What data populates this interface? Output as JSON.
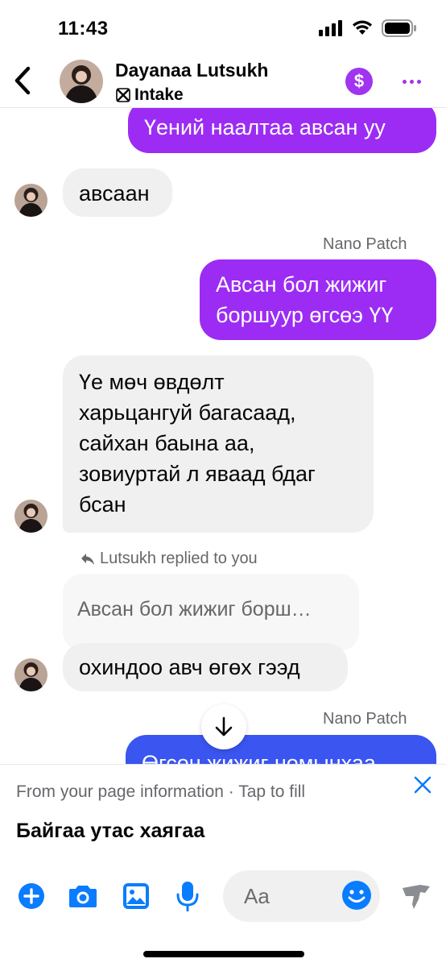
{
  "status_bar": {
    "time": "11:43"
  },
  "header": {
    "contact_name": "Dayanaa Lutsukh",
    "channel_label": "Intake"
  },
  "messages": [
    {
      "id": "m1",
      "direction": "outgoing",
      "text": "Үений наалтаа авсан уу"
    },
    {
      "id": "m2",
      "direction": "incoming",
      "text": "авсаан"
    },
    {
      "id": "m3",
      "direction": "outgoing",
      "sender": "Nano Patch",
      "lines": [
        "Авсан бол жижиг",
        "боршуур өгсөэ ҮҮ"
      ]
    },
    {
      "id": "m4",
      "direction": "incoming",
      "lines": [
        "Үе мөч өвдөлт",
        "харьцангуй багасаад,",
        "сайхан баына аа,",
        "зовиуртай л яваад бдаг",
        "бсан"
      ]
    },
    {
      "id": "m5",
      "direction": "incoming",
      "reply_label": "Lutsukh replied to you",
      "quoted": "Авсан бол жижиг борш…",
      "text": "охиндоо авч өгөх гээд"
    },
    {
      "id": "m6",
      "direction": "outgoing",
      "sender": "Nano Patch",
      "text": "Өгсөн жижиг номынхаа"
    }
  ],
  "suggestion": {
    "hint": "From your page information · Tap to fill",
    "text": "Байгаа утас хаягаа"
  },
  "composer": {
    "placeholder": "Aa"
  },
  "colors": {
    "accent_purple": "#9c2cf3",
    "accent_blue": "#0a7cff",
    "incoming_bubble": "#f0f0f0",
    "muted_text": "#65676b"
  },
  "icons": {
    "back": "chevron-left-icon",
    "payment": "dollar-icon",
    "more": "more-dots-icon",
    "scroll": "arrow-down-icon",
    "close": "close-icon",
    "add": "plus-circle-icon",
    "camera": "camera-icon",
    "gallery": "image-icon",
    "mic": "microphone-icon",
    "emoji": "smile-icon",
    "like": "like-icon"
  }
}
